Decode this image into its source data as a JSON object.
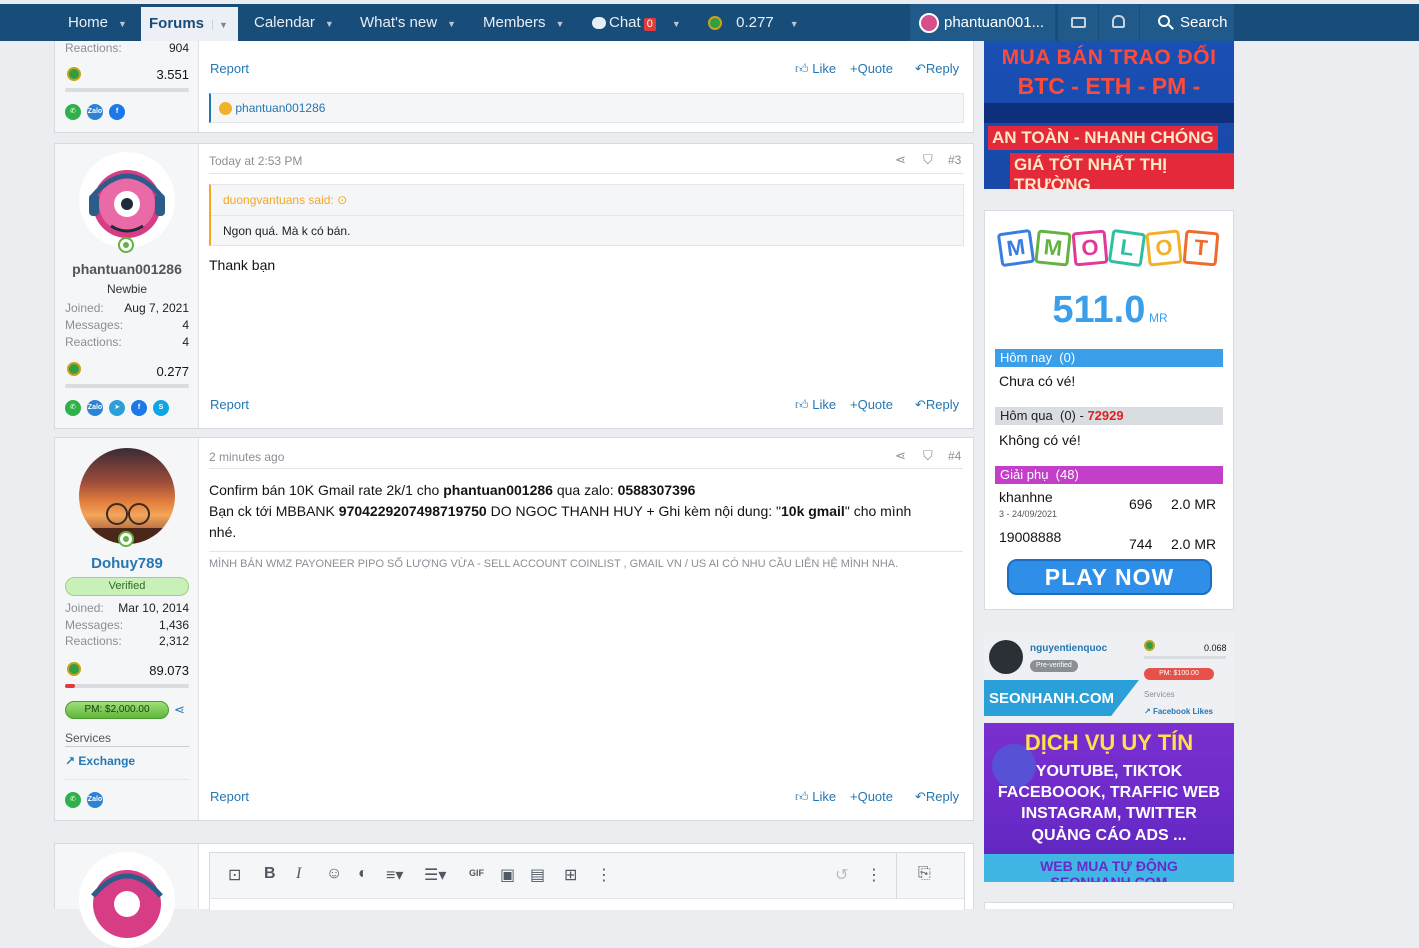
{
  "nav": {
    "items": [
      {
        "label": "Home"
      },
      {
        "label": "Forums"
      },
      {
        "label": "Calendar"
      },
      {
        "label": "What's new"
      },
      {
        "label": "Members"
      }
    ],
    "chat_label": "Chat",
    "chat_count": "0",
    "points": "0.277",
    "username": "phantuan001...",
    "search_label": "Search"
  },
  "post1": {
    "reactions_label": "Reactions:",
    "reactions": "904",
    "points": "3.551",
    "report": "Report",
    "like": "Like",
    "quote": "+Quote",
    "reply": "Reply",
    "reacted_by": "phantuan001286"
  },
  "post3": {
    "time": "Today at 2:53 PM",
    "number": "#3",
    "quote_author": "duongvantuans said:",
    "quote_text": "Ngon quá. Mà k có bán.",
    "body": "Thank bạn",
    "user": {
      "name": "phantuan001286",
      "title": "Newbie",
      "joined_label": "Joined:",
      "joined": "Aug 7, 2021",
      "messages_label": "Messages:",
      "messages": "4",
      "reactions_label": "Reactions:",
      "reactions": "4",
      "points": "0.277"
    },
    "report": "Report",
    "like": "Like",
    "quote": "+Quote",
    "reply": "Reply"
  },
  "post4": {
    "time": "2 minutes ago",
    "number": "#4",
    "line1_a": "Confirm bán 10K Gmail rate 2k/1 cho ",
    "line1_b": "phantuan001286",
    "line1_c": " qua zalo: ",
    "line1_d": "0588307396",
    "line2_a": "Bạn ck tới MBBANK ",
    "line2_b": "9704229207498719750",
    "line2_c": " DO NGOC THANH HUY + Ghi kèm nội dung: \"",
    "line2_d": "10k gmail",
    "line2_e": "\" cho mình",
    "line3": "nhé.",
    "signature": "MÌNH BÁN WMZ PAYONEER PIPO SỐ LƯỢNG VỪA - SELL ACCOUNT COINLIST , GMAIL VN / US AI CÓ NHU CẦU LIÊN HỆ MÌNH NHA.",
    "user": {
      "name": "Dohuy789",
      "badge": "Verified",
      "joined_label": "Joined:",
      "joined": "Mar 10, 2014",
      "messages_label": "Messages:",
      "messages": "1,436",
      "reactions_label": "Reactions:",
      "reactions": "2,312",
      "points": "89.073",
      "pm_badge": "PM: $2,000.00",
      "services_label": "Services",
      "exchange_label": "Exchange"
    },
    "report": "Report",
    "like": "Like",
    "quote": "+Quote",
    "reply": "Reply"
  },
  "ad_top": {
    "line1": "MUA BÁN TRAO ĐỔI",
    "line2": "BTC - ETH - PM - USDT",
    "line3": "AN TOÀN - NHANH CHÓNG",
    "line4": "GIÁ TỐT NHẤT THỊ TRƯỜNG"
  },
  "lottery": {
    "letters": [
      "M",
      "M",
      "O",
      "L",
      "O",
      "T"
    ],
    "amount": "511.0",
    "unit": "MR",
    "today_label": "Hôm nay",
    "today_count": "(0)",
    "today_text": "Chưa có vé!",
    "yesterday_label": "Hôm qua",
    "yesterday_count": "(0) -",
    "yesterday_number": "72929",
    "yesterday_text": "Không có vé!",
    "sub_label": "Giải phụ",
    "sub_count": "(48)",
    "winners": [
      {
        "name": "khanhne",
        "date": "3 - 24/09/2021",
        "num": "696",
        "amount": "2.0 MR"
      },
      {
        "name": "19008888",
        "date": "",
        "num": "744",
        "amount": "2.0 MR"
      }
    ],
    "play_label": "PLAY NOW"
  },
  "ad_seo": {
    "username": "nguyentienquoc",
    "pre_verified": "Pre-verified",
    "points": "0.068",
    "pm": "PM: $100.00",
    "services": "Services",
    "fb_likes": "Facebook Likes",
    "site": "SEONHANH.COM",
    "title": "DỊCH VỤ UY TÍN",
    "l1": "YOUTUBE, TIKTOK",
    "l2": "FACEBOOOK, TRAFFIC WEB",
    "l3": "INSTAGRAM, TWITTER",
    "l4": "QUẢNG CÁO ADS ...",
    "footer": "WEB MUA TỰ ĐỘNG SEONHANH.COM"
  },
  "colors": {
    "nav": "#184d7a",
    "link": "#2577b1",
    "lottery_blue": "#3a9ee8",
    "sub_purple": "#c43fc9",
    "play_blue": "#2f8fe8"
  }
}
